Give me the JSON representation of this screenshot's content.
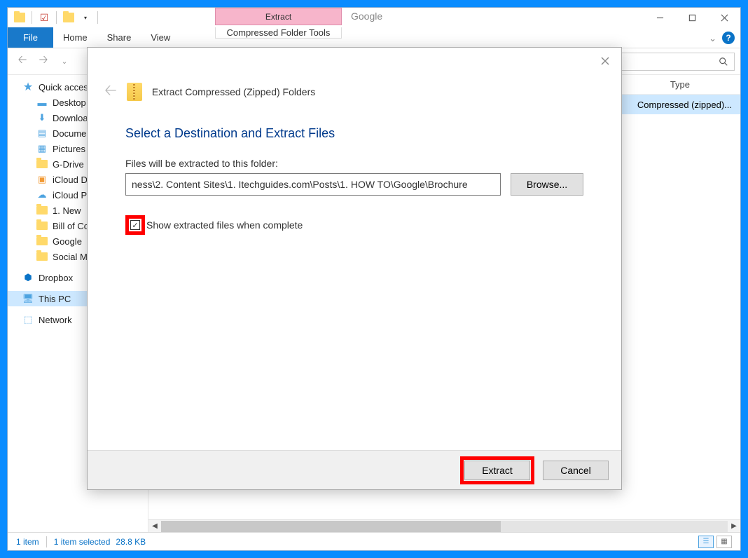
{
  "titlebar": {
    "context_tab": "Extract",
    "window_title": "Google"
  },
  "ribbon": {
    "file": "File",
    "home": "Home",
    "share": "Share",
    "view": "View",
    "context": "Compressed Folder Tools"
  },
  "sidebar": {
    "quick_access": "Quick access",
    "items": [
      "Desktop",
      "Downloads",
      "Documents",
      "Pictures",
      "G-Drive",
      "iCloud Drive",
      "iCloud Photos",
      "1. New",
      "Bill of Costs",
      "Google",
      "Social Media"
    ],
    "dropbox": "Dropbox",
    "this_pc": "This PC",
    "network": "Network"
  },
  "columns": {
    "type": "Type"
  },
  "content_row": {
    "type": "Compressed (zipped)..."
  },
  "statusbar": {
    "items": "1 item",
    "selected": "1 item selected",
    "size": "28.8 KB"
  },
  "dialog": {
    "header_title": "Extract Compressed (Zipped) Folders",
    "heading": "Select a Destination and Extract Files",
    "label": "Files will be extracted to this folder:",
    "path": "ness\\2. Content Sites\\1. Itechguides.com\\Posts\\1. HOW TO\\Google\\Brochure",
    "browse": "Browse...",
    "checkbox_label": "Show extracted files when complete",
    "extract": "Extract",
    "cancel": "Cancel"
  }
}
